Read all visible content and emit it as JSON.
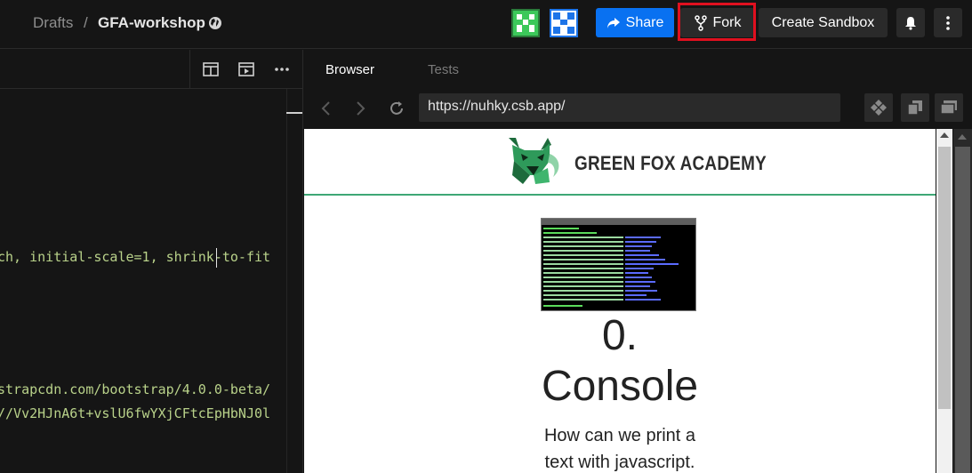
{
  "header": {
    "breadcrumb_root": "Drafts",
    "breadcrumb_separator": "/",
    "sandbox_name": "GFA-workshop",
    "share_label": "Share",
    "fork_label": "Fork",
    "create_label": "Create Sandbox",
    "colors": {
      "share": "#0971f1",
      "highlight": "#e0101f",
      "avatar_green": "#3cc85a",
      "avatar_blue": "#1d74e8"
    }
  },
  "editor": {
    "code_lines": [
      "ch, initial-scale=1, shrink-to-fit",
      "strapcdn.com/bootstrap/4.0.0-beta/",
      "//Vv2HJnA6t+vslU6fwYXjCFtcEpHbNJ0l"
    ]
  },
  "browser": {
    "tabs": [
      {
        "label": "Browser",
        "active": true
      },
      {
        "label": "Tests",
        "active": false
      }
    ],
    "url": "https://nuhky.csb.app/",
    "preview": {
      "brand": "GREEN FOX ACADEMY",
      "heading_number": "0.",
      "heading_title": "Console",
      "subtitle_line1": "How can we print a",
      "subtitle_line2": "text with javascript.",
      "accent": "#3ea776"
    }
  }
}
